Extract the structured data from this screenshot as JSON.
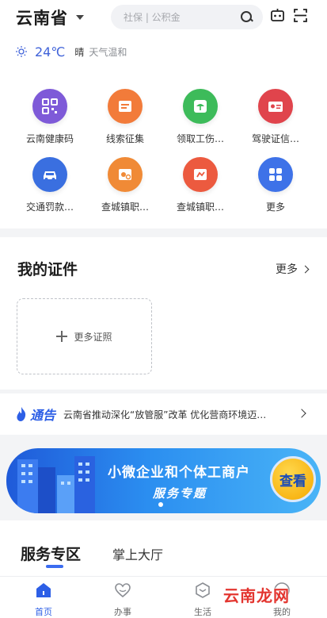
{
  "header": {
    "province": "云南省",
    "search_placeholder": "社保 | 公积金"
  },
  "weather": {
    "temperature": "24℃",
    "condition": "晴",
    "description": "天气温和"
  },
  "services": [
    {
      "label": "云南健康码",
      "icon": "qr-code-icon",
      "color": "#7e5ad8"
    },
    {
      "label": "线索征集",
      "icon": "report-icon",
      "color": "#f27b3a"
    },
    {
      "label": "领取工伤…",
      "icon": "umbrella-icon",
      "color": "#3dbb5a"
    },
    {
      "label": "驾驶证信…",
      "icon": "license-icon",
      "color": "#e0444c"
    },
    {
      "label": "交通罚款…",
      "icon": "car-icon",
      "color": "#3a6fe0"
    },
    {
      "label": "查城镇职…",
      "icon": "pension-icon",
      "color": "#f08a36"
    },
    {
      "label": "查城镇职…",
      "icon": "pension-icon",
      "color": "#ec5a3f"
    },
    {
      "label": "更多",
      "icon": "more-grid-icon",
      "color": "#3e72e8"
    }
  ],
  "certificates": {
    "title": "我的证件",
    "more": "更多",
    "add_label": "更多证照"
  },
  "notice": {
    "badge": "通告",
    "text": "云南省推动深化“放管服”改革 优化营商环境迈…"
  },
  "banner": {
    "line1": "小微企业和个体工商户",
    "line2": "服务专题",
    "button": "查看"
  },
  "service_zone": {
    "tabs": [
      "服务专区",
      "掌上大厅"
    ]
  },
  "bottom_nav": {
    "items": [
      {
        "label": "首页",
        "active": true
      },
      {
        "label": "办事",
        "active": false
      },
      {
        "label": "生活",
        "active": false
      },
      {
        "label": "我的",
        "active": false
      }
    ]
  },
  "watermark": "云南龙网",
  "colors": {
    "accent": "#2d5fe6",
    "temperature": "#3f62d9",
    "banner_start": "#1f5ad9",
    "banner_end": "#49b4f7"
  }
}
